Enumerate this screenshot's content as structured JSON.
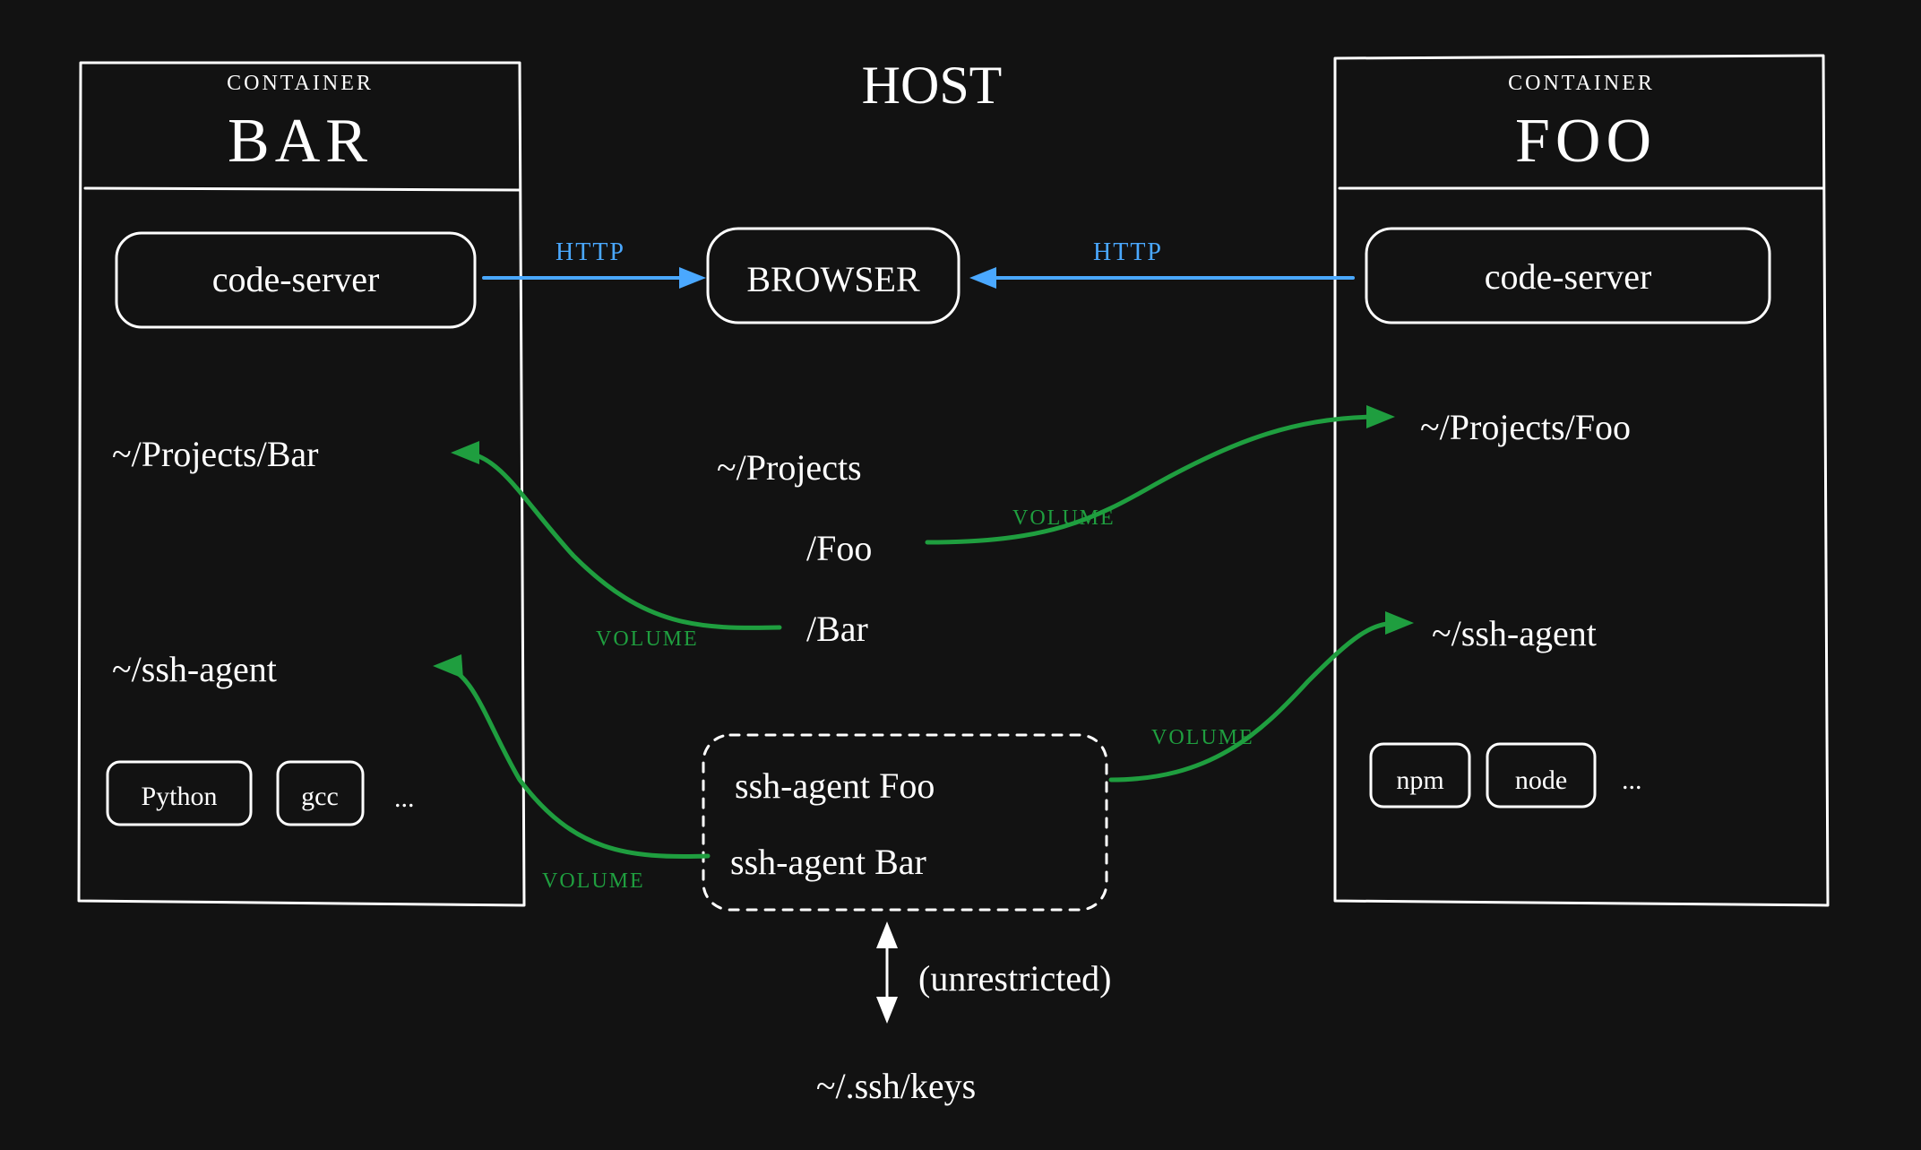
{
  "host": {
    "title": "HOST",
    "browser": "BROWSER",
    "projects_root": "~/Projects",
    "project_foo": "/Foo",
    "project_bar": "/Bar",
    "ssh_agent_foo": "ssh-agent Foo",
    "ssh_agent_bar": "ssh-agent Bar",
    "unrestricted": "(unrestricted)",
    "ssh_keys": "~/.ssh/keys"
  },
  "container_bar": {
    "label_top": "CONTAINER",
    "name": "BAR",
    "code_server": "code-server",
    "projects_path": "~/Projects/Bar",
    "ssh_agent": "~/ssh-agent",
    "tool1": "Python",
    "tool2": "gcc",
    "more": "..."
  },
  "container_foo": {
    "label_top": "CONTAINER",
    "name": "FOO",
    "code_server": "code-server",
    "projects_path": "~/Projects/Foo",
    "ssh_agent": "~/ssh-agent",
    "tool1": "npm",
    "tool2": "node",
    "more": "..."
  },
  "labels": {
    "http_left": "HTTP",
    "http_right": "HTTP",
    "volume1": "VOLUME",
    "volume2": "VOLUME",
    "volume3": "VOLUME",
    "volume4": "VOLUME"
  },
  "colors": {
    "bg": "#121212",
    "fg": "#ffffff",
    "http": "#4aa8ff",
    "volume": "#1f9e3f"
  }
}
